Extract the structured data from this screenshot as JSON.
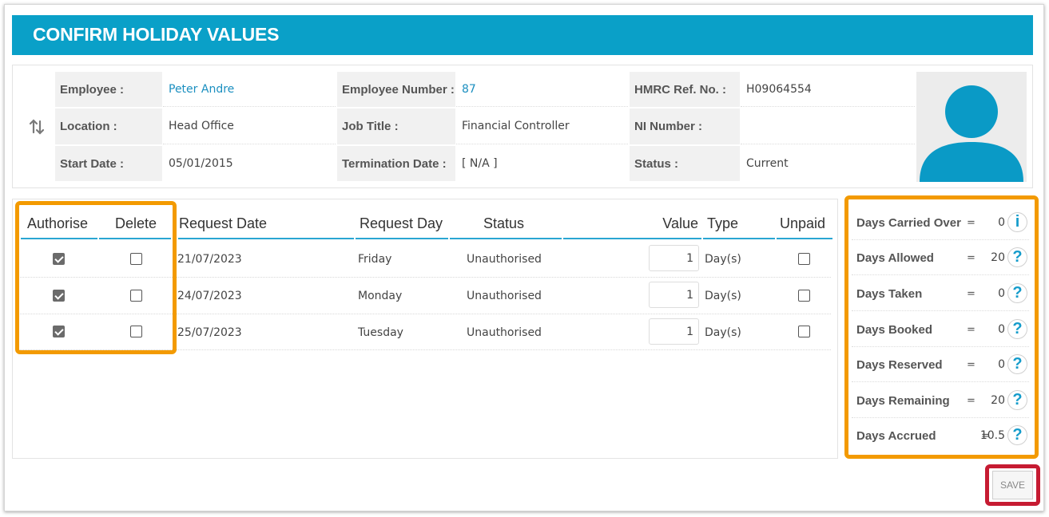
{
  "title": "CONFIRM HOLIDAY VALUES",
  "employee": {
    "employee_label": "Employee :",
    "employee_value": "Peter Andre",
    "employee_number_label": "Employee Number :",
    "employee_number_value": "87",
    "hmrc_label": "HMRC Ref. No. :",
    "hmrc_value": "H09064554",
    "location_label": "Location :",
    "location_value": "Head Office",
    "job_title_label": "Job Title :",
    "job_title_value": "Financial Controller",
    "ni_label": "NI Number :",
    "ni_value": "",
    "start_date_label": "Start Date :",
    "start_date_value": "05/01/2015",
    "termination_label": "Termination Date :",
    "termination_value": "[ N/A ]",
    "status_label": "Status :",
    "status_value": "Current"
  },
  "table": {
    "headers": {
      "authorise": "Authorise",
      "delete": "Delete",
      "request_date": "Request Date",
      "request_day": "Request Day",
      "status": "Status",
      "value": "Value",
      "type": "Type",
      "unpaid": "Unpaid"
    },
    "rows": [
      {
        "authorise": true,
        "delete": false,
        "date": "21/07/2023",
        "day": "Friday",
        "status": "Unauthorised",
        "value": "1",
        "type": "Day(s)",
        "unpaid": false
      },
      {
        "authorise": true,
        "delete": false,
        "date": "24/07/2023",
        "day": "Monday",
        "status": "Unauthorised",
        "value": "1",
        "type": "Day(s)",
        "unpaid": false
      },
      {
        "authorise": true,
        "delete": false,
        "date": "25/07/2023",
        "day": "Tuesday",
        "status": "Unauthorised",
        "value": "1",
        "type": "Day(s)",
        "unpaid": false
      }
    ]
  },
  "summary": [
    {
      "label": "Days Carried Over",
      "eq": "=",
      "value": "0",
      "icon": "i"
    },
    {
      "label": "Days Allowed",
      "eq": "=",
      "value": "20",
      "icon": "?"
    },
    {
      "label": "Days Taken",
      "eq": "=",
      "value": "0",
      "icon": "?"
    },
    {
      "label": "Days Booked",
      "eq": "=",
      "value": "0",
      "icon": "?"
    },
    {
      "label": "Days Reserved",
      "eq": "=",
      "value": "0",
      "icon": "?"
    },
    {
      "label": "Days Remaining",
      "eq": "=",
      "value": "20",
      "icon": "?"
    },
    {
      "label": "Days Accrued",
      "eq": "=",
      "value": "10.5",
      "icon": "?"
    }
  ],
  "save_label": "SAVE",
  "colors": {
    "accent": "#0aa0c8",
    "highlight_orange": "#f39a00",
    "highlight_red": "#c61b32",
    "link": "#1b8fc0"
  }
}
